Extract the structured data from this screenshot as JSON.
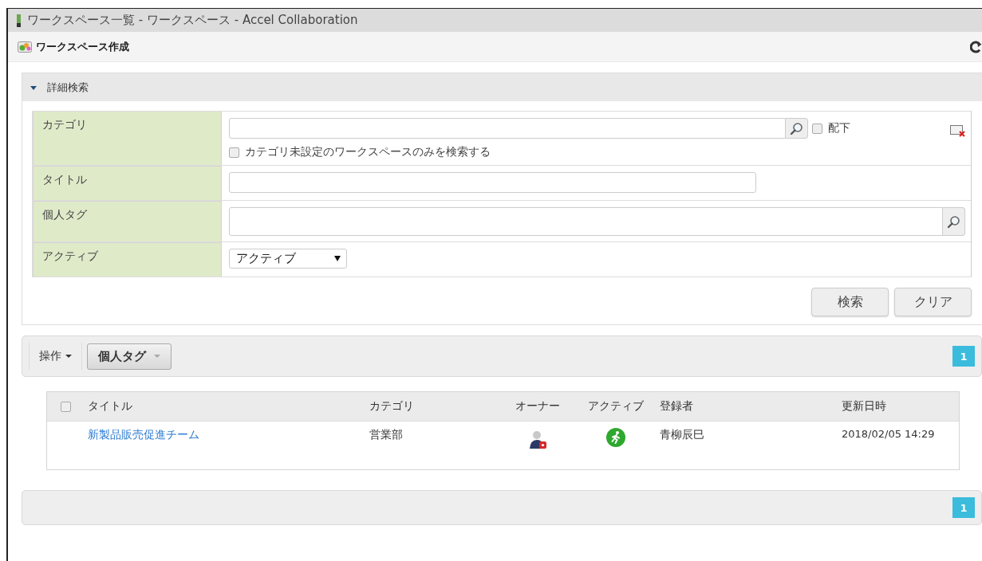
{
  "window": {
    "title": "ワークスペース一覧 - ワークスペース - Accel Collaboration"
  },
  "toolbar": {
    "create_label": "ワークスペース作成"
  },
  "search_panel": {
    "title": "詳細検索",
    "expanded": true,
    "fields": [
      {
        "kind": "category",
        "label": "カテゴリ",
        "sub_checkbox": {
          "label": "配下",
          "checked": false
        },
        "option": {
          "label": "カテゴリ未設定のワークスペースのみを検索する",
          "checked": false
        }
      },
      {
        "kind": "text",
        "label": "タイトル"
      },
      {
        "kind": "tag",
        "label": "個人タグ"
      },
      {
        "kind": "select",
        "label": "アクティブ",
        "value": "アクティブ"
      }
    ],
    "buttons": [
      "検索",
      "クリア"
    ]
  },
  "action_bar": {
    "operation_label": "操作",
    "tag_button": "個人タグ",
    "page": "1"
  },
  "table": {
    "select_all": {
      "checked": false
    },
    "columns": [
      "タイトル",
      "カテゴリ",
      "オーナー",
      "アクティブ",
      "登録者",
      "更新日時"
    ],
    "rows": [
      {
        "title": "新製品販売促進チーム",
        "category": "営業部",
        "owner": true,
        "active": true,
        "registrant": "青柳辰巳",
        "updated": "2018/02/05 14:29"
      }
    ]
  },
  "bottom_pager": {
    "page": "1"
  }
}
